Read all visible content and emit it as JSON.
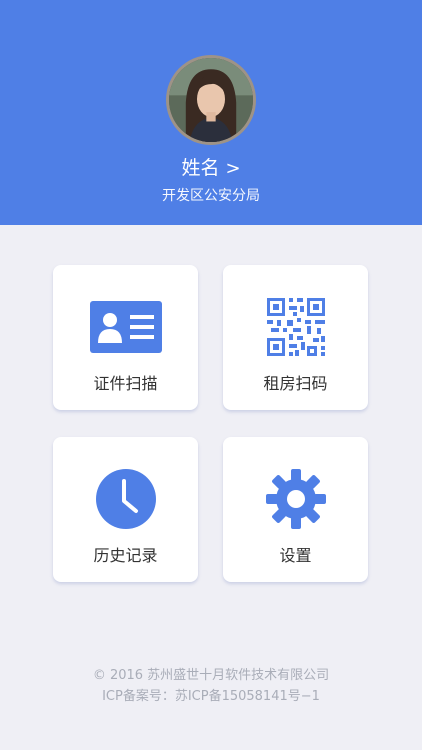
{
  "theme": {
    "primary": "#4f7fe6",
    "background": "#efeff5",
    "card": "#ffffff",
    "footer_text": "#a9adb8"
  },
  "profile": {
    "avatar_icon": "user-avatar-photo",
    "name": "姓名",
    "chevron": ">",
    "department": "开发区公安分局"
  },
  "menu": [
    {
      "label": "证件扫描",
      "icon": "id-card-icon"
    },
    {
      "label": "租房扫码",
      "icon": "qr-code-icon"
    },
    {
      "label": "历史记录",
      "icon": "clock-icon"
    },
    {
      "label": "设置",
      "icon": "gear-icon"
    }
  ],
  "footer": {
    "copyright": "© 2016 苏州盛世十月软件技术有限公司",
    "icp": "ICP备案号：苏ICP备15058141号−1"
  }
}
